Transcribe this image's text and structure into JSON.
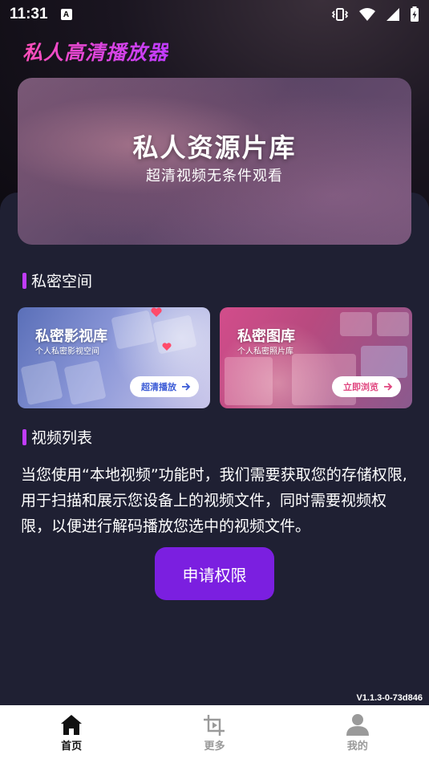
{
  "status_bar": {
    "time": "11:31",
    "notification_glyph": "A"
  },
  "app": {
    "title": "私人高清播放器"
  },
  "hero": {
    "title": "私人资源片库",
    "subtitle": "超清视频无条件观看"
  },
  "sections": {
    "private_space": "私密空间",
    "video_list": "视频列表"
  },
  "cards": [
    {
      "title": "私密影视库",
      "subtitle": "个人私密影视空间",
      "button": "超清播放",
      "accent": "#3b5bd6"
    },
    {
      "title": "私密图库",
      "subtitle": "个人私密照片库",
      "button": "立即浏览",
      "accent": "#e0457f"
    }
  ],
  "permission": {
    "text": "当您使用“本地视频”功能时，我们需要获取您的存储权限,用于扫描和展示您设备上的视频文件，同时需要视频权限，以便进行解码播放您选中的视频文件。",
    "button": "申请权限"
  },
  "version": "V1.1.3-0-73d846",
  "bottom_nav": [
    {
      "label": "首页",
      "icon": "home-icon",
      "active": true
    },
    {
      "label": "更多",
      "icon": "more-icon",
      "active": false
    },
    {
      "label": "我的",
      "icon": "profile-icon",
      "active": false
    }
  ],
  "colors": {
    "background": "#1f2033",
    "accent_purple": "#c13cff",
    "button_purple": "#7b1fe0",
    "title_gradient_start": "#ff4fb8"
  }
}
